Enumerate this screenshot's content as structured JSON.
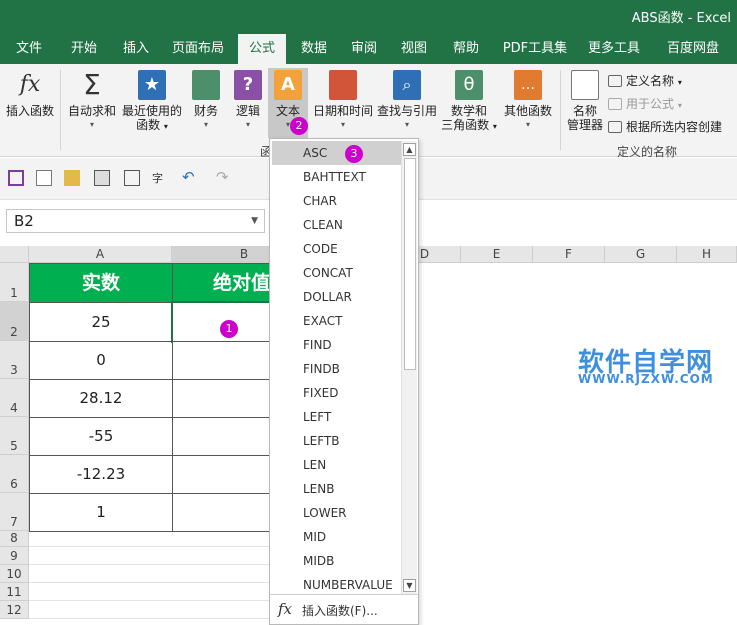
{
  "window": {
    "title": "ABS函数  -  Excel"
  },
  "tabs": [
    "文件",
    "开始",
    "插入",
    "页面布局",
    "公式",
    "数据",
    "审阅",
    "视图",
    "帮助",
    "PDF工具集",
    "更多工具",
    "百度网盘"
  ],
  "active_tab": "公式",
  "ribbon": {
    "insert_function": "插入函数",
    "autosum": "自动求和",
    "recent_line1": "最近使用的",
    "recent_line2": "函数",
    "financial": "财务",
    "logical": "逻辑",
    "text": "文本",
    "datetime": "日期和时间",
    "lookup": "查找与引用",
    "math_line1": "数学和",
    "math_line2": "三角函数",
    "other": "其他函数",
    "name_mgr_line1": "名称",
    "name_mgr_line2": "管理器",
    "define_name": "定义名称",
    "use_in_formula": "用于公式",
    "create_from_selection": "根据所选内容创建",
    "group_library": "函",
    "group_names": "定义的名称"
  },
  "namebox": {
    "value": "B2"
  },
  "columns": [
    "A",
    "B",
    "",
    "D",
    "E",
    "F",
    "G",
    "H"
  ],
  "rows": [
    "1",
    "2",
    "3",
    "4",
    "5",
    "6",
    "7",
    "8",
    "9",
    "10",
    "11",
    "12"
  ],
  "table": {
    "header_a": "实数",
    "header_b": "绝对值",
    "values": [
      "25",
      "0",
      "28.12",
      "-55",
      "-12.23",
      "1"
    ]
  },
  "dropdown": {
    "items": [
      "ASC",
      "BAHTTEXT",
      "CHAR",
      "CLEAN",
      "CODE",
      "CONCAT",
      "DOLLAR",
      "EXACT",
      "FIND",
      "FINDB",
      "FIXED",
      "LEFT",
      "LEFTB",
      "LEN",
      "LENB",
      "LOWER",
      "MID",
      "MIDB",
      "NUMBERVALUE"
    ],
    "footer": "插入函数(F)..."
  },
  "badges": [
    "1",
    "2",
    "3"
  ],
  "watermark": {
    "line1": "软件自学网",
    "line2": "WWW.RJZXW.COM"
  },
  "colors": {
    "excel_green": "#217346",
    "header_green": "#00b050",
    "badge": "#cc00cc",
    "watermark": "#3f8fe0"
  }
}
